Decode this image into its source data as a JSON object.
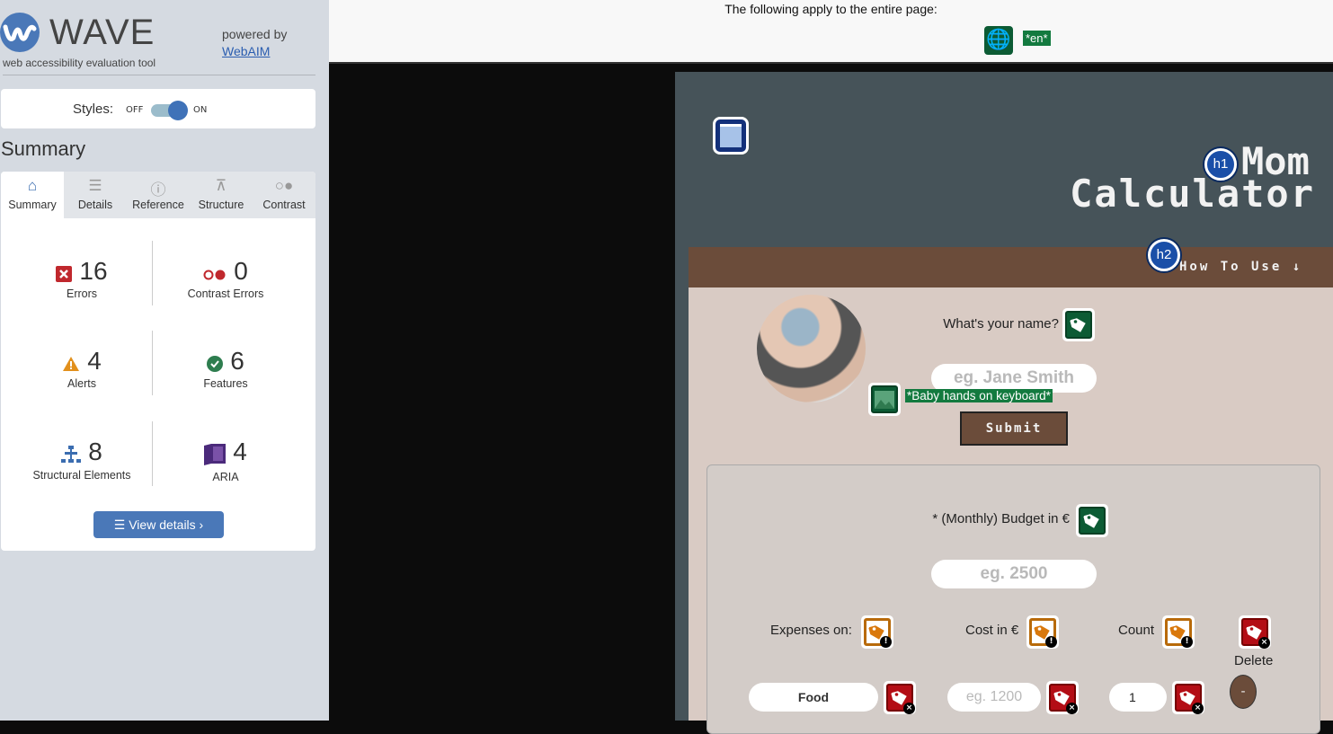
{
  "sidebar": {
    "title": "WAVE",
    "subtitle": "web accessibility evaluation tool",
    "powered_by": "powered by",
    "webaim_link": "WebAIM",
    "styles": {
      "label": "Styles:",
      "off": "OFF",
      "on": "ON",
      "state": "on"
    },
    "summary_heading": "Summary",
    "tabs": [
      {
        "label": "Summary",
        "icon": "home-icon"
      },
      {
        "label": "Details",
        "icon": "list-icon"
      },
      {
        "label": "Reference",
        "icon": "info-icon"
      },
      {
        "label": "Structure",
        "icon": "structure-icon"
      },
      {
        "label": "Contrast",
        "icon": "contrast-icon"
      }
    ],
    "stats": [
      {
        "count": "16",
        "label": "Errors",
        "icon": "error-icon",
        "color": "#c0282d"
      },
      {
        "count": "0",
        "label": "Contrast Errors",
        "icon": "contrast-error-icon",
        "color": "#c0282d"
      },
      {
        "count": "4",
        "label": "Alerts",
        "icon": "alert-icon",
        "color": "#e2901c"
      },
      {
        "count": "6",
        "label": "Features",
        "icon": "feature-icon",
        "color": "#2e7d4f"
      },
      {
        "count": "8",
        "label": "Structural Elements",
        "icon": "structure-icon",
        "color": "#3b6db0"
      },
      {
        "count": "4",
        "label": "ARIA",
        "icon": "aria-icon",
        "color": "#4b2a7b"
      }
    ],
    "view_details": "View details ›"
  },
  "topbar": {
    "text": "The following apply to the entire page:",
    "lang": "*en*"
  },
  "page": {
    "h1_badge": "h1",
    "h2_badge": "h2",
    "title_line1": "Mom",
    "title_line2": "Calculator",
    "nav_link": "How To Use ↓",
    "name_label": "What's your name?",
    "name_placeholder": "eg. Jane Smith",
    "image_alt": "*Baby hands on keyboard*",
    "submit": "Submit",
    "budget_label": "* (Monthly) Budget in €",
    "budget_placeholder": "eg. 2500",
    "col_expenses": "Expenses on:",
    "col_cost": "Cost in €",
    "col_count": "Count",
    "col_delete": "Delete",
    "row": {
      "expense_value": "Food",
      "cost_placeholder": "eg. 1200",
      "count_value": "1",
      "delete_button": "-"
    }
  }
}
